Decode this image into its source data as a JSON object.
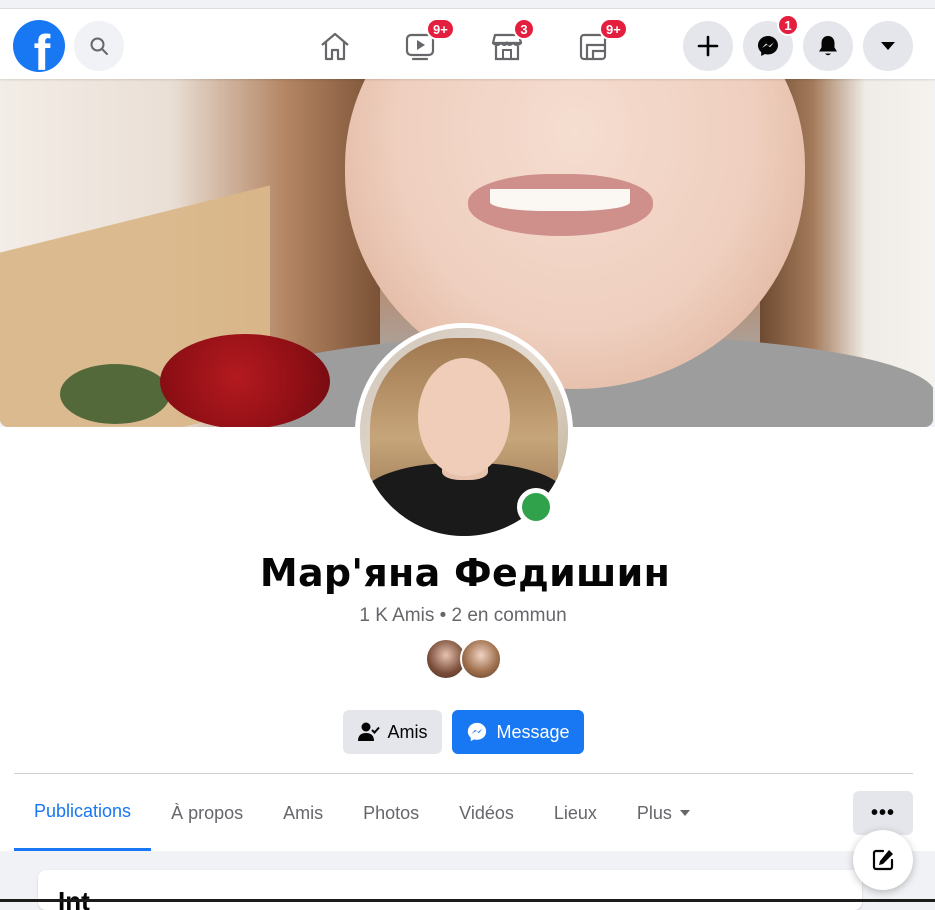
{
  "nav": {
    "logo_letter": "f",
    "icons": {
      "search": "search-icon",
      "home": "home-icon",
      "watch": "watch-icon",
      "marketplace": "marketplace-icon",
      "groups": "groups-icon",
      "create": "plus-icon",
      "messenger": "messenger-icon",
      "notifications": "bell-icon",
      "account": "caret-down-icon"
    },
    "badges": {
      "watch": "9+",
      "marketplace": "3",
      "groups": "9+",
      "messenger": "1"
    }
  },
  "profile": {
    "name": "Мар'яна Федишин",
    "friends_summary": "1 K Amis • 2 en commun",
    "status": "online"
  },
  "actions": {
    "friends_label": "Amis",
    "message_label": "Message"
  },
  "tabs": [
    {
      "label": "Publications",
      "active": true
    },
    {
      "label": "À propos"
    },
    {
      "label": "Amis"
    },
    {
      "label": "Photos"
    },
    {
      "label": "Vidéos"
    },
    {
      "label": "Lieux"
    },
    {
      "label": "Plus"
    }
  ],
  "more_label": "•••",
  "card": {
    "title": "Int"
  },
  "colors": {
    "brand": "#1877f2",
    "badge": "#e41e3f",
    "online": "#31a24c"
  }
}
